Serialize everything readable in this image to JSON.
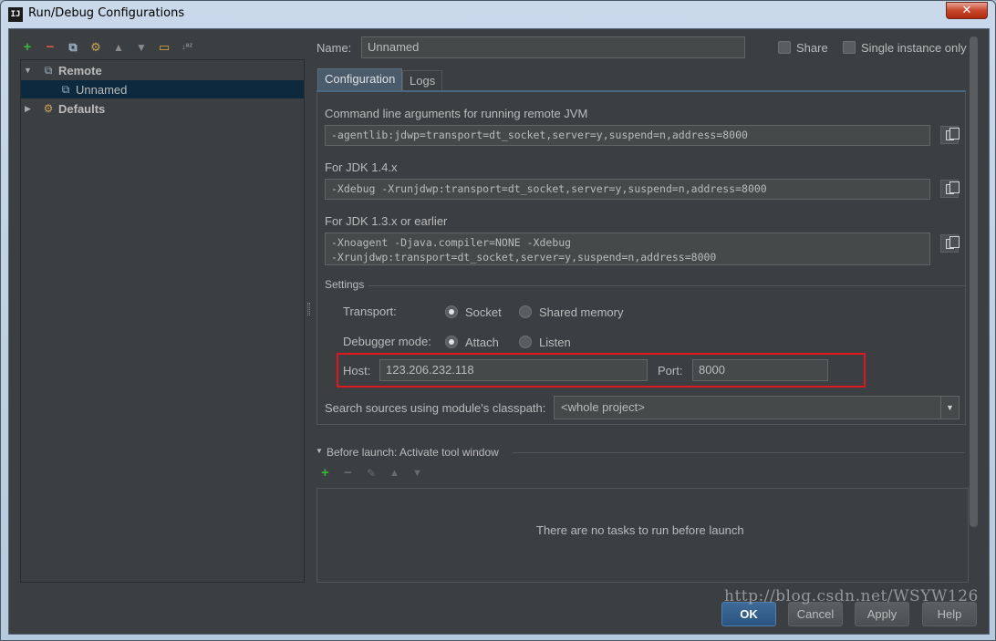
{
  "window": {
    "title": "Run/Debug Configurations",
    "app_icon": "IJ",
    "close_symbol": "✕"
  },
  "toolbar": {
    "icons": [
      "add-icon",
      "remove-icon",
      "copy-icon",
      "wrench-icon",
      "move-up-icon",
      "move-down-icon",
      "folder-icon",
      "sort-alpha-icon"
    ]
  },
  "tree": {
    "items": [
      {
        "label": "Remote",
        "expanded": true
      },
      {
        "label": "Unnamed",
        "selected": true
      },
      {
        "label": "Defaults",
        "expanded": false
      }
    ]
  },
  "form": {
    "name_label": "Name:",
    "name_value": "Unnamed",
    "share_label": "Share",
    "single_instance_label": "Single instance only"
  },
  "tabs": [
    {
      "label": "Configuration",
      "active": true
    },
    {
      "label": "Logs",
      "active": false
    }
  ],
  "config": {
    "cmd_label": "Command line arguments for running remote JVM",
    "cmd_value": "-agentlib:jdwp=transport=dt_socket,server=y,suspend=n,address=8000",
    "jdk14_label": "For JDK 1.4.x",
    "jdk14_value": "-Xdebug -Xrunjdwp:transport=dt_socket,server=y,suspend=n,address=8000",
    "jdk13_label": "For JDK 1.3.x or earlier",
    "jdk13_line1": "-Xnoagent -Djava.compiler=NONE -Xdebug",
    "jdk13_line2": "-Xrunjdwp:transport=dt_socket,server=y,suspend=n,address=8000",
    "settings_label": "Settings",
    "transport_label": "Transport:",
    "transport_socket": "Socket",
    "transport_shared": "Shared memory",
    "debugger_label": "Debugger mode:",
    "debugger_attach": "Attach",
    "debugger_listen": "Listen",
    "host_label": "Host:",
    "host_value": "123.206.232.118",
    "port_label": "Port:",
    "port_value": "8000",
    "classpath_label": "Search sources using module's classpath:",
    "classpath_value": "<whole project>"
  },
  "before_launch": {
    "label": "Before launch: Activate tool window",
    "empty_text": "There are no tasks to run before launch"
  },
  "buttons": {
    "ok": "OK",
    "cancel": "Cancel",
    "apply": "Apply",
    "help": "Help"
  },
  "watermark": "http://blog.csdn.net/WSYW126",
  "colors": {
    "accent": "#4a6784",
    "highlight_box": "#e0181d",
    "add": "#3fb13b",
    "remove": "#d45b4c"
  }
}
